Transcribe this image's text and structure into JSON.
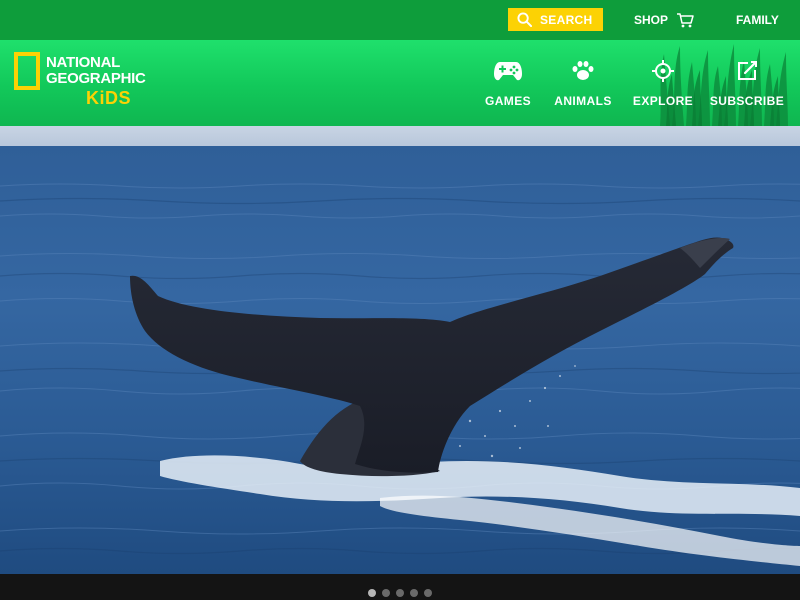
{
  "topbar": {
    "search_label": "SEARCH",
    "search_icon": "search-icon",
    "shop_label": "SHOP",
    "shop_icon": "cart-icon",
    "family_label": "FAMILY"
  },
  "logo": {
    "line1": "NATIONAL",
    "line2": "GEOGRAPHIC",
    "line3": "KiDS"
  },
  "nav": {
    "items": [
      {
        "label": "GAMES",
        "icon": "gamepad-icon"
      },
      {
        "label": "ANIMALS",
        "icon": "paw-icon"
      },
      {
        "label": "EXPLORE",
        "icon": "target-icon"
      },
      {
        "label": "SUBSCRIBE",
        "icon": "edit-icon"
      }
    ]
  },
  "hero": {
    "image": "whale-tail-photo"
  },
  "carousel": {
    "count": 5,
    "active_index": 0
  },
  "colors": {
    "topbar_bg": "#0e9d3b",
    "nav_bg": "#12c85a",
    "accent_yellow": "#fcd204",
    "ocean": "#2d5d95"
  }
}
